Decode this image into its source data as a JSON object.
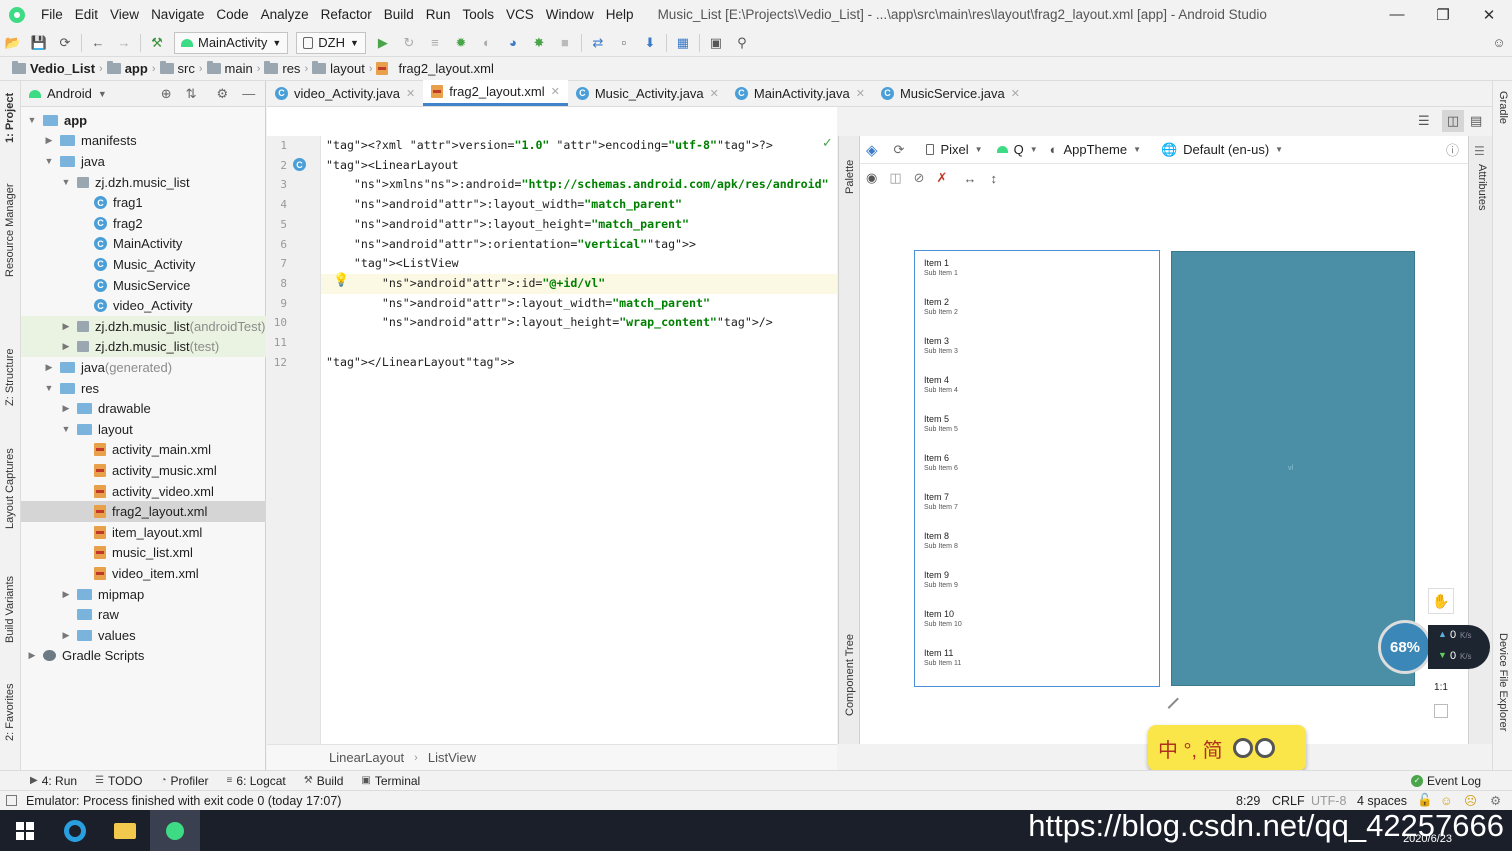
{
  "menu": [
    "File",
    "Edit",
    "View",
    "Navigate",
    "Code",
    "Analyze",
    "Refactor",
    "Build",
    "Run",
    "Tools",
    "VCS",
    "Window",
    "Help"
  ],
  "window_title": "Music_List [E:\\Projects\\Vedio_List] - ...\\app\\src\\main\\res\\layout\\frag2_layout.xml [app] - Android Studio",
  "toolbar": {
    "run_config": "MainActivity",
    "device": "DZH"
  },
  "navbar": [
    "Vedio_List",
    "app",
    "src",
    "main",
    "res",
    "layout",
    "frag2_layout.xml"
  ],
  "left_stripe": [
    "1: Project",
    "Resource Manager",
    "Z: Structure",
    "Layout Captures",
    "Build Variants",
    "2: Favorites"
  ],
  "right_stripe": [
    "Gradle",
    "Attributes",
    "Device File Explorer"
  ],
  "project": {
    "view": "Android",
    "tree": [
      {
        "label": "app",
        "level": 0,
        "icon": "folder-icon",
        "arrow": "down",
        "bold": true
      },
      {
        "label": "manifests",
        "level": 1,
        "icon": "folder-icon",
        "arrow": "right"
      },
      {
        "label": "java",
        "level": 1,
        "icon": "folder-icon",
        "arrow": "down"
      },
      {
        "label": "zj.dzh.music_list",
        "level": 2,
        "icon": "package-icon",
        "arrow": "down"
      },
      {
        "label": "frag1",
        "level": 3,
        "icon": "class-icon"
      },
      {
        "label": "frag2",
        "level": 3,
        "icon": "class-icon"
      },
      {
        "label": "MainActivity",
        "level": 3,
        "icon": "class-icon"
      },
      {
        "label": "Music_Activity",
        "level": 3,
        "icon": "class-icon"
      },
      {
        "label": "MusicService",
        "level": 3,
        "icon": "class-icon"
      },
      {
        "label": "video_Activity",
        "level": 3,
        "icon": "class-icon"
      },
      {
        "label": "zj.dzh.music_list",
        "suffix": " (androidTest)",
        "level": 2,
        "icon": "package-icon",
        "arrow": "right",
        "test": true
      },
      {
        "label": "zj.dzh.music_list",
        "suffix": " (test)",
        "level": 2,
        "icon": "package-icon",
        "arrow": "right",
        "test": true
      },
      {
        "label": "java",
        "suffix": " (generated)",
        "level": 1,
        "icon": "folder-icon",
        "arrow": "right"
      },
      {
        "label": "res",
        "level": 1,
        "icon": "folder-icon",
        "arrow": "down"
      },
      {
        "label": "drawable",
        "level": 2,
        "icon": "folder-icon",
        "arrow": "right"
      },
      {
        "label": "layout",
        "level": 2,
        "icon": "folder-icon",
        "arrow": "down"
      },
      {
        "label": "activity_main.xml",
        "level": 3,
        "icon": "xml-icon"
      },
      {
        "label": "activity_music.xml",
        "level": 3,
        "icon": "xml-icon"
      },
      {
        "label": "activity_video.xml",
        "level": 3,
        "icon": "xml-icon"
      },
      {
        "label": "frag2_layout.xml",
        "level": 3,
        "icon": "xml-icon",
        "selected": true
      },
      {
        "label": "item_layout.xml",
        "level": 3,
        "icon": "xml-icon"
      },
      {
        "label": "music_list.xml",
        "level": 3,
        "icon": "xml-icon"
      },
      {
        "label": "video_item.xml",
        "level": 3,
        "icon": "xml-icon"
      },
      {
        "label": "mipmap",
        "level": 2,
        "icon": "folder-icon",
        "arrow": "right"
      },
      {
        "label": "raw",
        "level": 2,
        "icon": "folder-icon"
      },
      {
        "label": "values",
        "level": 2,
        "icon": "folder-icon",
        "arrow": "right"
      },
      {
        "label": "Gradle Scripts",
        "level": 0,
        "icon": "gradle-icon",
        "arrow": "right"
      }
    ]
  },
  "tabs": [
    {
      "label": "video_Activity.java",
      "icon": "class-icon"
    },
    {
      "label": "frag2_layout.xml",
      "icon": "xml-icon",
      "active": true
    },
    {
      "label": "Music_Activity.java",
      "icon": "class-icon"
    },
    {
      "label": "MainActivity.java",
      "icon": "class-icon"
    },
    {
      "label": "MusicService.java",
      "icon": "class-icon"
    }
  ],
  "code_lines": [
    "<?xml version=\"1.0\" encoding=\"utf-8\"?>",
    "<LinearLayout",
    "    xmlns:android=\"http://schemas.android.com/apk/res/android\"",
    "    android:layout_width=\"match_parent\"",
    "    android:layout_height=\"match_parent\"",
    "    android:orientation=\"vertical\">",
    "    <ListView",
    "        android:id=\"@+id/vl\"",
    "        android:layout_width=\"match_parent\"",
    "        android:layout_height=\"wrap_content\"/>",
    "",
    "</LinearLayout>"
  ],
  "code_breadcrumb": [
    "LinearLayout",
    "ListView"
  ],
  "design_toolbar": {
    "device": "Pixel",
    "api": "Q",
    "theme": "AppTheme",
    "locale": "Default (en-us)"
  },
  "preview_items": [
    {
      "title": "Item 1",
      "sub": "Sub Item 1"
    },
    {
      "title": "Item 2",
      "sub": "Sub Item 2"
    },
    {
      "title": "Item 3",
      "sub": "Sub Item 3"
    },
    {
      "title": "Item 4",
      "sub": "Sub Item 4"
    },
    {
      "title": "Item 5",
      "sub": "Sub Item 5"
    },
    {
      "title": "Item 6",
      "sub": "Sub Item 6"
    },
    {
      "title": "Item 7",
      "sub": "Sub Item 7"
    },
    {
      "title": "Item 8",
      "sub": "Sub Item 8"
    },
    {
      "title": "Item 9",
      "sub": "Sub Item 9"
    },
    {
      "title": "Item 10",
      "sub": "Sub Item 10"
    },
    {
      "title": "Item 11",
      "sub": "Sub Item 11"
    }
  ],
  "blueprint_label": "vl",
  "zoom_label": "1:1",
  "palette_label": "Palette",
  "component_tree_label": "Component Tree",
  "bottom_tools": [
    {
      "label": "4: Run",
      "icon": "run-icon"
    },
    {
      "label": "TODO",
      "icon": "todo-icon"
    },
    {
      "label": "Profiler",
      "icon": "profiler-icon"
    },
    {
      "label": "6: Logcat",
      "icon": "logcat-icon"
    },
    {
      "label": "Build",
      "icon": "build-icon"
    },
    {
      "label": "Terminal",
      "icon": "terminal-icon"
    }
  ],
  "event_log": "Event Log",
  "status": {
    "message": "Emulator: Process finished with exit code 0 (today 17:07)",
    "position": "8:29",
    "line_ending": "CRLF",
    "encoding": "UTF-8",
    "indent": "4 spaces"
  },
  "speed_widget": {
    "percent": "68%",
    "up": "0",
    "down": "0",
    "unit": "K/s"
  },
  "ime": {
    "text": "中 °, 简"
  },
  "watermark": "https://blog.csdn.net/qq_42257666",
  "date": "2020/6/23",
  "colors": {
    "accent": "#4083c9",
    "blueprint": "#4b8fa6",
    "selection": "#d5d5d5",
    "ime": "#fbe64a"
  }
}
